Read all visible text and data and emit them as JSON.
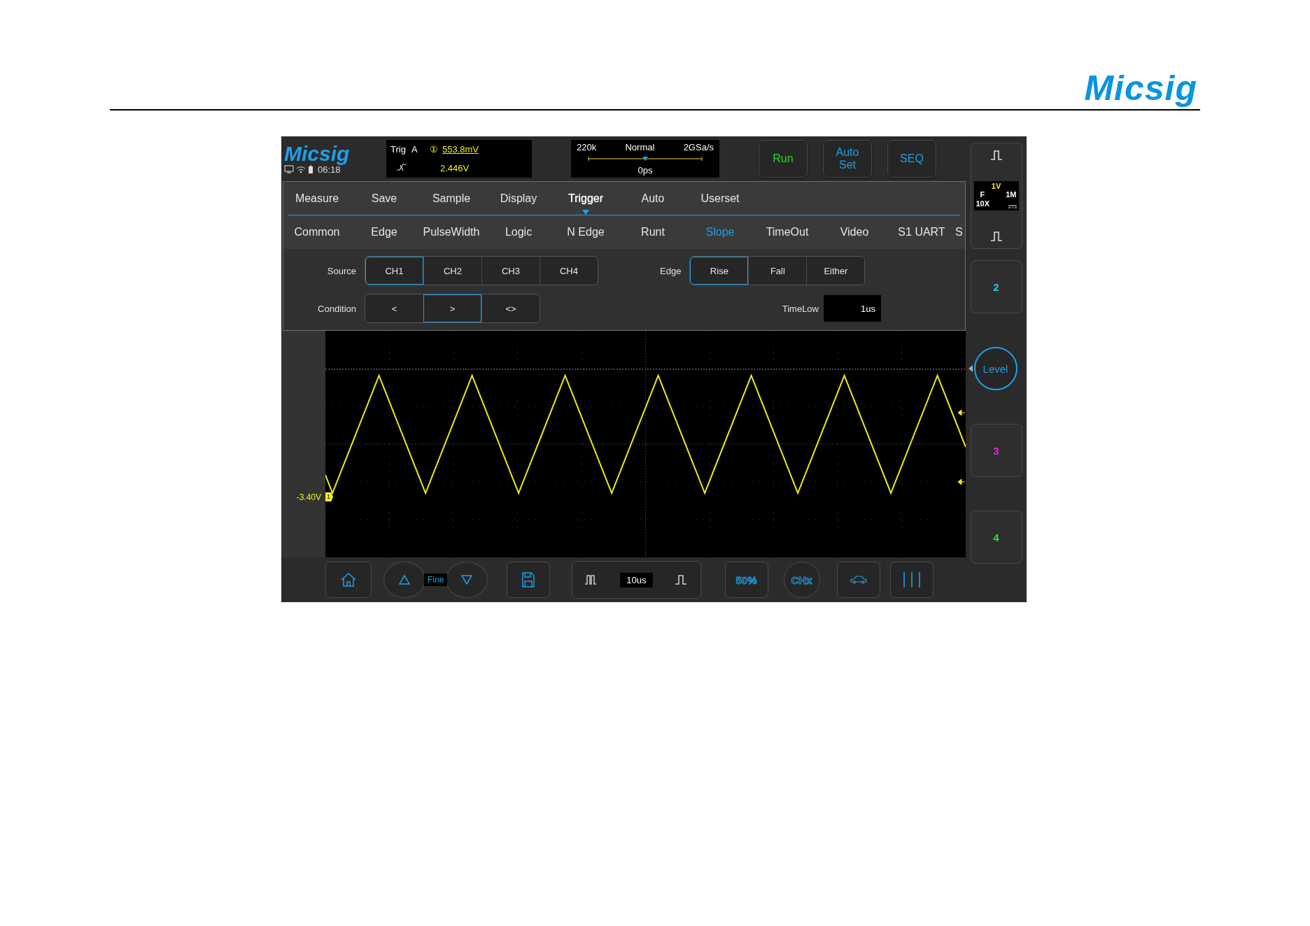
{
  "header": {
    "logo": "Micsig"
  },
  "scope": {
    "brand": {
      "logo": "Micsig",
      "clock": "06:18"
    },
    "trigger_info": {
      "label": "Trig",
      "source": "A",
      "channel": "①",
      "trigger_level": "553.8mV",
      "voltage": "2.446V"
    },
    "acquisition": {
      "memory_depth": "220k",
      "mode": "Normal",
      "sample_rate": "2GSa/s",
      "delay": "0ps"
    },
    "action_buttons": [
      {
        "label": "Run",
        "color": "#22dd22"
      },
      {
        "label": "Auto Set",
        "color": "#1ea0e8"
      },
      {
        "label": "SEQ",
        "color": "#1ea0e8"
      }
    ],
    "menu_tabs": [
      {
        "label": "Measure",
        "selected": false
      },
      {
        "label": "Save",
        "selected": false
      },
      {
        "label": "Sample",
        "selected": false
      },
      {
        "label": "Display",
        "selected": false
      },
      {
        "label": "Trigger",
        "selected": true
      },
      {
        "label": "Auto",
        "selected": false
      },
      {
        "label": "Userset",
        "selected": false
      }
    ],
    "trigger_types": [
      {
        "label": "Common",
        "selected": false
      },
      {
        "label": "Edge",
        "selected": false
      },
      {
        "label": "PulseWidth",
        "selected": false
      },
      {
        "label": "Logic",
        "selected": false
      },
      {
        "label": "N Edge",
        "selected": false
      },
      {
        "label": "Runt",
        "selected": false
      },
      {
        "label": "Slope",
        "selected": true
      },
      {
        "label": "TimeOut",
        "selected": false
      },
      {
        "label": "Video",
        "selected": false
      },
      {
        "label": "S1 UART",
        "selected": false
      },
      {
        "label": "S",
        "selected": false
      }
    ],
    "source": {
      "label": "Source",
      "options": [
        {
          "label": "CH1",
          "selected": true
        },
        {
          "label": "CH2",
          "selected": false
        },
        {
          "label": "CH3",
          "selected": false
        },
        {
          "label": "CH4",
          "selected": false
        }
      ]
    },
    "edge": {
      "label": "Edge",
      "options": [
        {
          "label": "Rise",
          "selected": true
        },
        {
          "label": "Fall",
          "selected": false
        },
        {
          "label": "Either",
          "selected": false
        }
      ]
    },
    "condition": {
      "label": "Condition",
      "options": [
        {
          "label": "<",
          "selected": false
        },
        {
          "label": ">",
          "selected": true
        },
        {
          "label": "<>",
          "selected": false
        }
      ]
    },
    "time_low": {
      "label": "TimeLow",
      "value": "1us"
    },
    "waveform": {
      "offset_label": "-3.40V",
      "marker": "1"
    },
    "bottom_bar": {
      "fine_label": "Fine",
      "timebase": "10us",
      "trigger_50": "50%",
      "channel_select": "CHx"
    },
    "ch1_info": {
      "scale": "1V",
      "filter": "F",
      "impedance": "1M",
      "probe": "10X"
    },
    "level_button": "Level",
    "channels": [
      {
        "label": "2",
        "color": "#29c4f0"
      },
      {
        "label": "3",
        "color": "#e028e0"
      },
      {
        "label": "4",
        "color": "#2ee02e"
      }
    ]
  }
}
